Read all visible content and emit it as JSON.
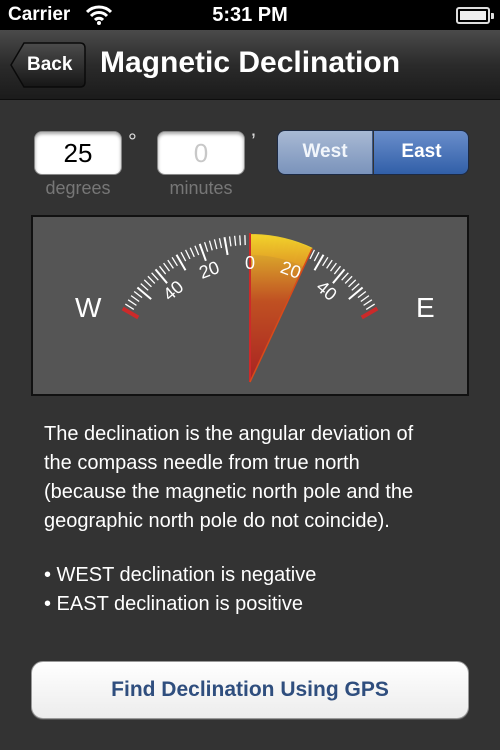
{
  "status_bar": {
    "carrier": "Carrier",
    "time": "5:31 PM"
  },
  "nav": {
    "back_label": "Back",
    "title": "Magnetic Declination"
  },
  "inputs": {
    "degrees_value": "25",
    "degrees_unit": "°",
    "degrees_caption": "degrees",
    "minutes_placeholder": "0",
    "minutes_unit": "’",
    "minutes_caption": "minutes"
  },
  "direction": {
    "options": [
      "West",
      "East"
    ],
    "selected": "East"
  },
  "dial": {
    "left_label": "W",
    "right_label": "E",
    "scale_labels": [
      "40",
      "20",
      "0",
      "20",
      "40"
    ],
    "needle_degrees": 25,
    "highlight_color": "#f2d22a",
    "needle_color": "#b42020"
  },
  "description": {
    "lines": [
      "The declination is the angular deviation of",
      "the compass needle from true north",
      "(because the magnetic north pole and the",
      "geographic north pole do not coincide)."
    ],
    "bullets": [
      "• WEST declination is negative",
      "• EAST declination is positive"
    ]
  },
  "gps_button": {
    "label": "Find Declination Using GPS"
  }
}
